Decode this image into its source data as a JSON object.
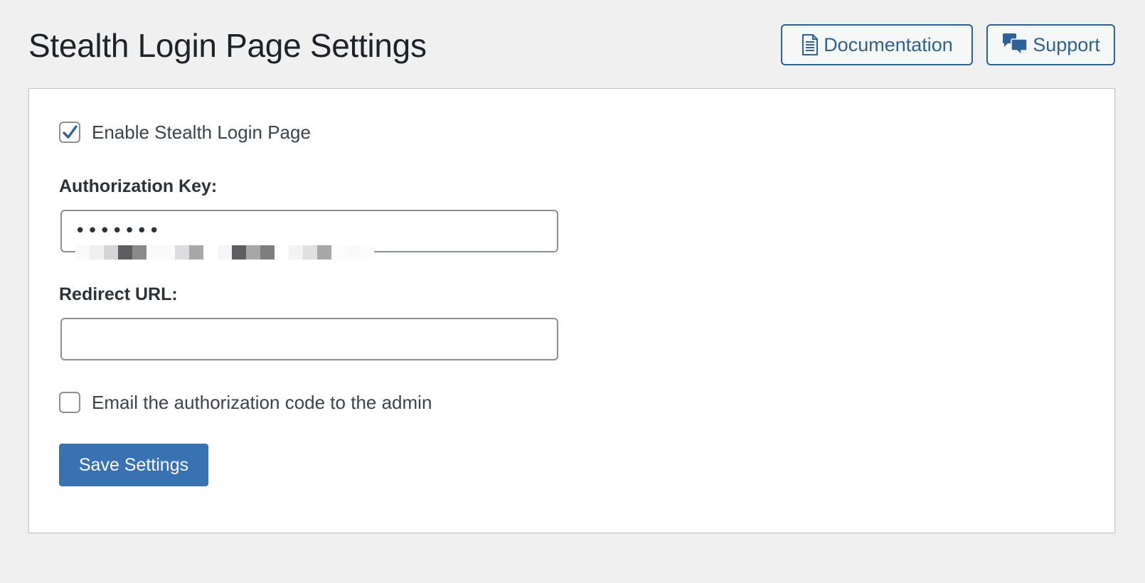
{
  "header": {
    "title": "Stealth Login Page Settings",
    "documentation_label": "Documentation",
    "support_label": "Support",
    "documentation_icon": "document-icon",
    "support_icon": "speech-bubbles-icon"
  },
  "form": {
    "enable": {
      "label": "Enable Stealth Login Page",
      "checked": true
    },
    "authorization_key": {
      "label": "Authorization Key:",
      "value": "•••••••"
    },
    "redirect_url": {
      "label": "Redirect URL:",
      "value": ""
    },
    "email_code": {
      "label": "Email the authorization code to the admin",
      "checked": false
    },
    "save_label": "Save Settings"
  },
  "colors": {
    "accent": "#2c6297",
    "primary_button": "#3872b2",
    "background": "#f0f0f1",
    "card": "#ffffff"
  }
}
